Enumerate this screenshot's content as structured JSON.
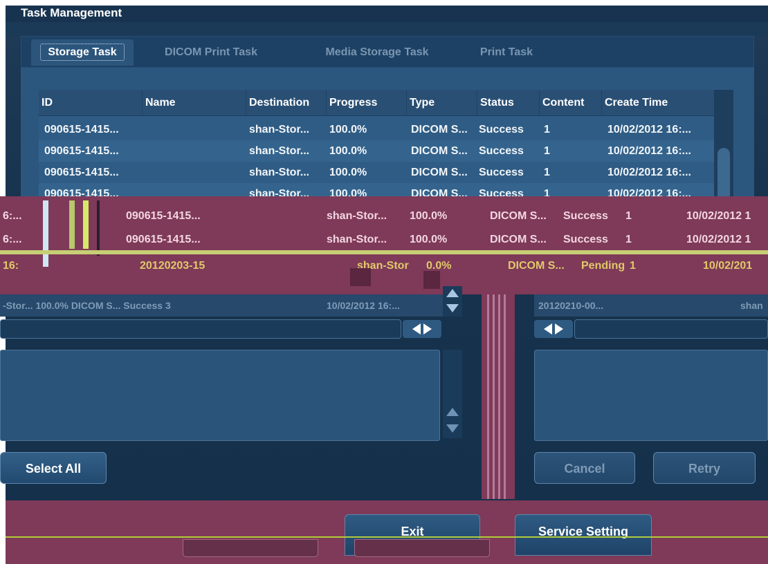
{
  "window": {
    "title": "Task Management"
  },
  "tabs": [
    {
      "label": "Storage Task",
      "active": true
    },
    {
      "label": "DICOM Print Task",
      "active": false
    },
    {
      "label": "Media Storage Task",
      "active": false
    },
    {
      "label": "Print Task",
      "active": false
    }
  ],
  "task_table": {
    "columns": [
      "ID",
      "Name",
      "Destination",
      "Progress",
      "Type",
      "Status",
      "Content",
      "Create Time"
    ],
    "rows": [
      {
        "id": "090615-1415...",
        "name": "",
        "destination": "shan-Stor...",
        "progress": "100.0%",
        "type": "DICOM S...",
        "status": "Success",
        "content": "1",
        "create_time": "10/02/2012 16:..."
      },
      {
        "id": "090615-1415...",
        "name": "",
        "destination": "shan-Stor...",
        "progress": "100.0%",
        "type": "DICOM S...",
        "status": "Success",
        "content": "1",
        "create_time": "10/02/2012 16:..."
      },
      {
        "id": "090615-1415...",
        "name": "",
        "destination": "shan-Stor...",
        "progress": "100.0%",
        "type": "DICOM S...",
        "status": "Success",
        "content": "1",
        "create_time": "10/02/2012 16:..."
      },
      {
        "id": "090615-1415...",
        "name": "",
        "destination": "shan-Stor...",
        "progress": "100.0%",
        "type": "DICOM S...",
        "status": "Success",
        "content": "1",
        "create_time": "10/02/2012 16:..."
      }
    ]
  },
  "glitch_rows": [
    {
      "prefix": "6:...",
      "id": "090615-1415...",
      "destination": "shan-Stor...",
      "progress": "100.0%",
      "type": "DICOM S...",
      "status": "Success",
      "content": "1",
      "create_time": "10/02/2012 1"
    },
    {
      "prefix": "6:...",
      "id": "090615-1415...",
      "destination": "shan-Stor...",
      "progress": "100.0%",
      "type": "DICOM S...",
      "status": "Success",
      "content": "1",
      "create_time": "10/02/2012 1"
    },
    {
      "prefix": "16:",
      "id": "20120203-15",
      "destination": "shan-Stor",
      "progress": "0.0%",
      "type": "DICOM S...",
      "status": "Pending",
      "content": "1",
      "create_time": "10/02/201"
    }
  ],
  "lower_left": {
    "row_text": "-Stor... 100.0% DICOM S... Success 3",
    "row_time": "10/02/2012 16:..."
  },
  "lower_right": {
    "row_text": "20120210-00...",
    "row_dest": "shan"
  },
  "buttons": {
    "select_all": "Select All",
    "cancel": "Cancel",
    "retry": "Retry",
    "exit": "Exit",
    "service_setting": "Service Setting"
  },
  "colors": {
    "background": "#17324d",
    "panel": "#2b577f",
    "glitch": "#7e3a58",
    "glitch_line": "#b2cc38"
  }
}
